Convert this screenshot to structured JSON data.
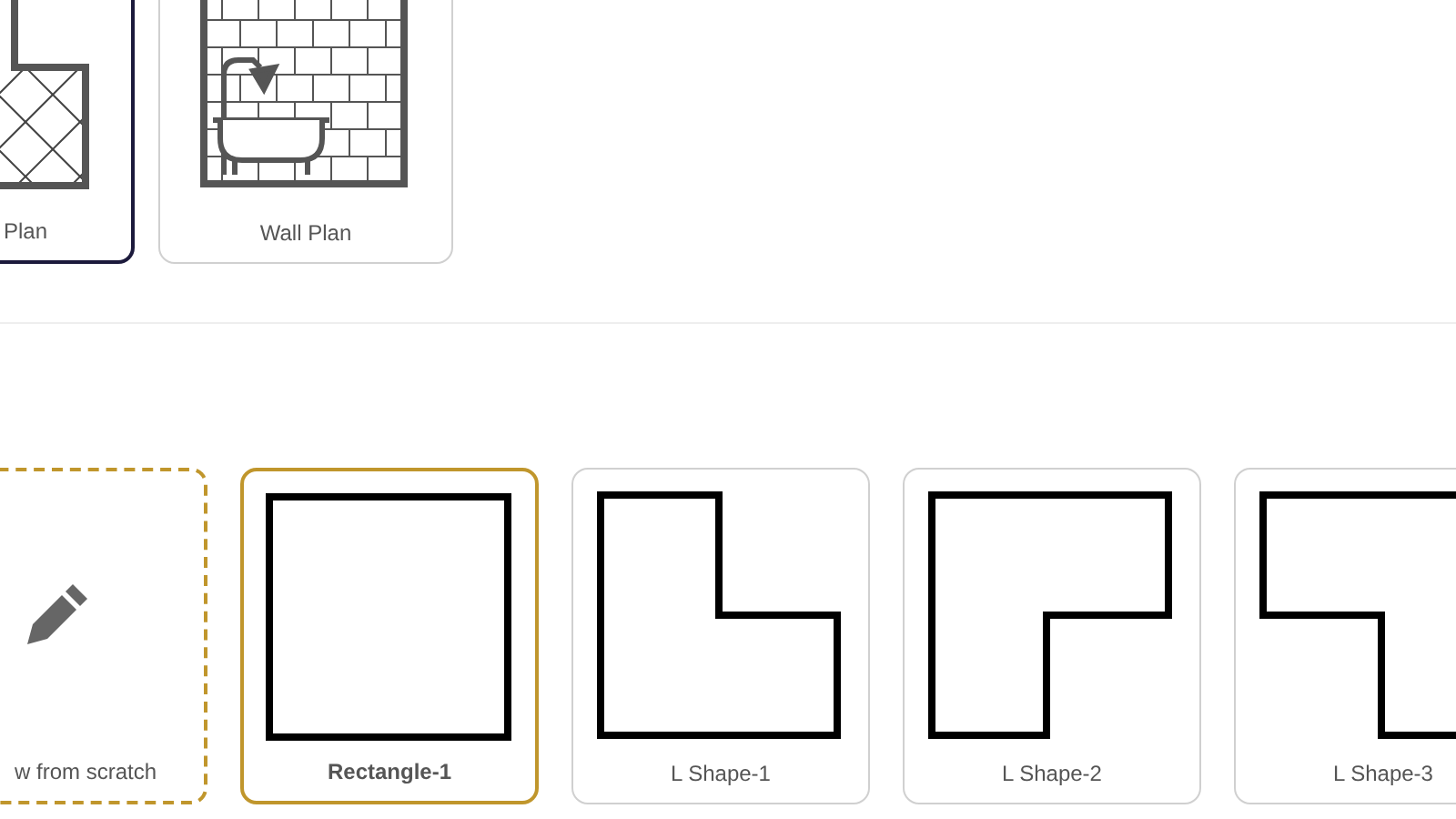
{
  "plan_types": [
    {
      "kind": "floor",
      "label": "Plan",
      "selected": true
    },
    {
      "kind": "wall",
      "label": "Wall Plan",
      "selected": false
    }
  ],
  "room_shapes": [
    {
      "kind": "scratch",
      "label": "w from scratch",
      "selected": false
    },
    {
      "kind": "rectangle",
      "label": "Rectangle-1",
      "selected": true
    },
    {
      "kind": "l1",
      "label": "L Shape-1",
      "selected": false
    },
    {
      "kind": "l2",
      "label": "L Shape-2",
      "selected": false
    },
    {
      "kind": "l3",
      "label": "L Shape-3",
      "selected": false
    }
  ]
}
